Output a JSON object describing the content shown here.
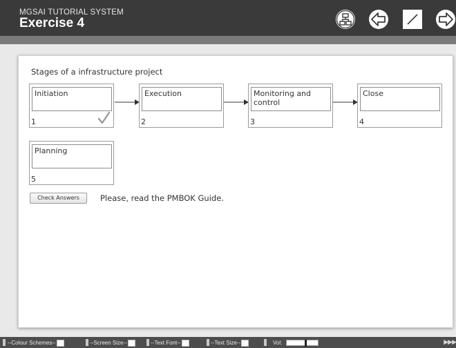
{
  "header": {
    "system_title": "MGSAI TUTORIAL SYSTEM",
    "exercise_title": "Exercise 4"
  },
  "nav_icons": [
    "sitemap-icon",
    "back-arrow-icon",
    "pencil-icon",
    "forward-arrow-icon"
  ],
  "activity": {
    "question": "Stages of a infrastructure project",
    "boxes": [
      {
        "text": "Initiation",
        "number": "1",
        "correct": true
      },
      {
        "text": "Execution",
        "number": "2",
        "correct": false
      },
      {
        "text": "Monitoring and control",
        "number": "3",
        "correct": false
      },
      {
        "text": "Close",
        "number": "4",
        "correct": false
      },
      {
        "text": "Planning",
        "number": "5",
        "correct": false
      }
    ],
    "check_button_label": "Check Answers",
    "feedback": "Please, read the PMBOK Guide."
  },
  "toolbar": {
    "colour_schemes": "--Colour Schemes--",
    "screen_size": "--Screen Size--",
    "text_font": "--Text Font--",
    "text_size": "--Text Size--",
    "volume_label": "Vol:",
    "volume_level": 0.6,
    "play_arrows": "▶▶▶"
  },
  "colors": {
    "header_bg": "#3a3a3a",
    "subbar_bg": "#7a7a7a",
    "toolbar_bg": "#4d4d4d",
    "check_mark": "#9a9a9a"
  }
}
